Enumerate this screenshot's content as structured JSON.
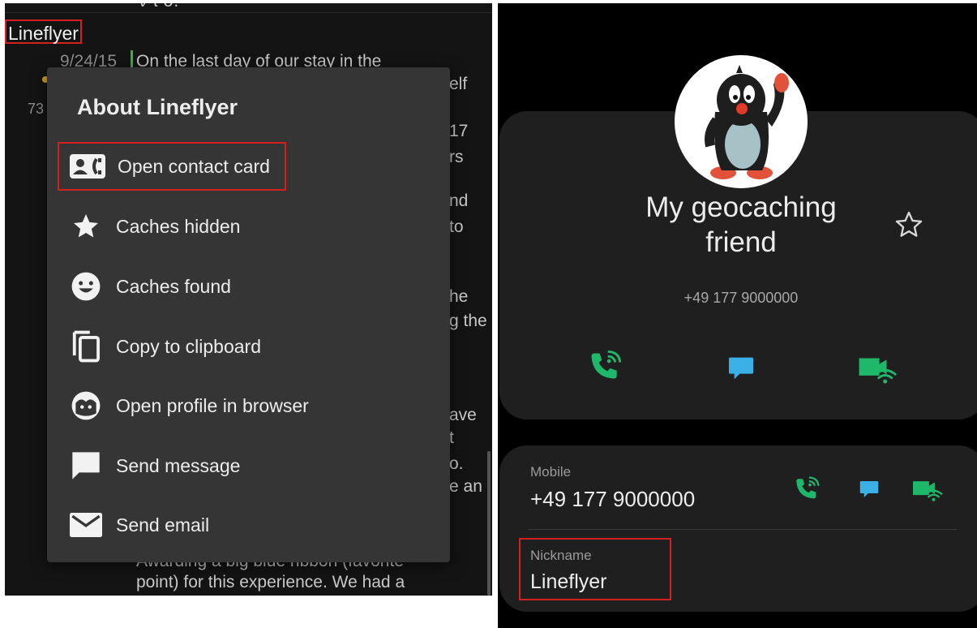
{
  "log": {
    "author": "Lineflyer",
    "date": "9/24/15",
    "first_line": "On the last day of our stay in the",
    "top_fragment": "ν τ σ.",
    "left_fragment": "73",
    "right_fragments": [
      "elf",
      "17",
      "rs",
      "nd",
      "to",
      "he",
      "g the",
      "ave",
      "t",
      "o.",
      "e an"
    ],
    "bottom_line_1": "Awarding a big blue ribbon (favorite",
    "bottom_line_2": "point) for this experience. We had a"
  },
  "dialog": {
    "title": "About Lineflyer",
    "items": [
      {
        "label": "Open contact card",
        "icon": "contact-card-icon"
      },
      {
        "label": "Caches hidden",
        "icon": "star-icon"
      },
      {
        "label": "Caches found",
        "icon": "smiley-icon"
      },
      {
        "label": "Copy to clipboard",
        "icon": "copy-icon"
      },
      {
        "label": "Open profile in browser",
        "icon": "face-icon"
      },
      {
        "label": "Send message",
        "icon": "message-icon"
      },
      {
        "label": "Send email",
        "icon": "email-icon"
      }
    ]
  },
  "contact": {
    "name_line_1": "My geocaching",
    "name_line_2": "friend",
    "phone": "+49 177 9000000",
    "mobile_label": "Mobile",
    "mobile_value": "+49 177 9000000",
    "nickname_label": "Nickname",
    "nickname_value": "Lineflyer"
  },
  "colors": {
    "accent_red": "#d32121",
    "call_green": "#1fb86a",
    "message_blue": "#3ab0e6",
    "card_bg": "#1f1f1f"
  }
}
